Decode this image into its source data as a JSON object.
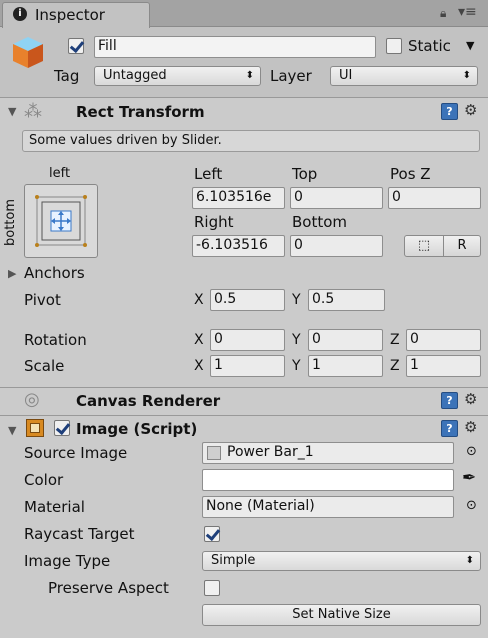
{
  "tab": {
    "title": "Inspector",
    "info_icon": "info-icon"
  },
  "object": {
    "active_checked": true,
    "name": "Fill",
    "static_label": "Static",
    "static_checked": false,
    "tag_label": "Tag",
    "tag_value": "Untagged",
    "layer_label": "Layer",
    "layer_value": "UI"
  },
  "rect_transform": {
    "title": "Rect Transform",
    "note": "Some values driven by Slider.",
    "anchor_top_label": "left",
    "anchor_side_label": "bottom",
    "left_label": "Left",
    "left_value": "6.103516e",
    "top_label": "Top",
    "top_value": "0",
    "posz_label": "Pos Z",
    "posz_value": "0",
    "right_label": "Right",
    "right_value": "-6.103516",
    "bottom_label": "Bottom",
    "bottom_value": "0",
    "blueprint_btn": "⬚",
    "raw_btn": "R",
    "anchors_label": "Anchors",
    "pivot_label": "Pivot",
    "pivot_x": "0.5",
    "pivot_y": "0.5",
    "rotation_label": "Rotation",
    "rot_x": "0",
    "rot_y": "0",
    "rot_z": "0",
    "scale_label": "Scale",
    "scale_x": "1",
    "scale_y": "1",
    "scale_z": "1",
    "x": "X",
    "y": "Y",
    "z": "Z"
  },
  "canvas_renderer": {
    "title": "Canvas Renderer"
  },
  "image": {
    "title": "Image (Script)",
    "enabled": true,
    "source_image_label": "Source Image",
    "source_image_value": "Power Bar_1",
    "color_label": "Color",
    "color_value": "#ffffff",
    "material_label": "Material",
    "material_value": "None (Material)",
    "raycast_label": "Raycast Target",
    "raycast_checked": true,
    "image_type_label": "Image Type",
    "image_type_value": "Simple",
    "preserve_label": "Preserve Aspect",
    "preserve_checked": false,
    "native_size_btn": "Set Native Size"
  }
}
